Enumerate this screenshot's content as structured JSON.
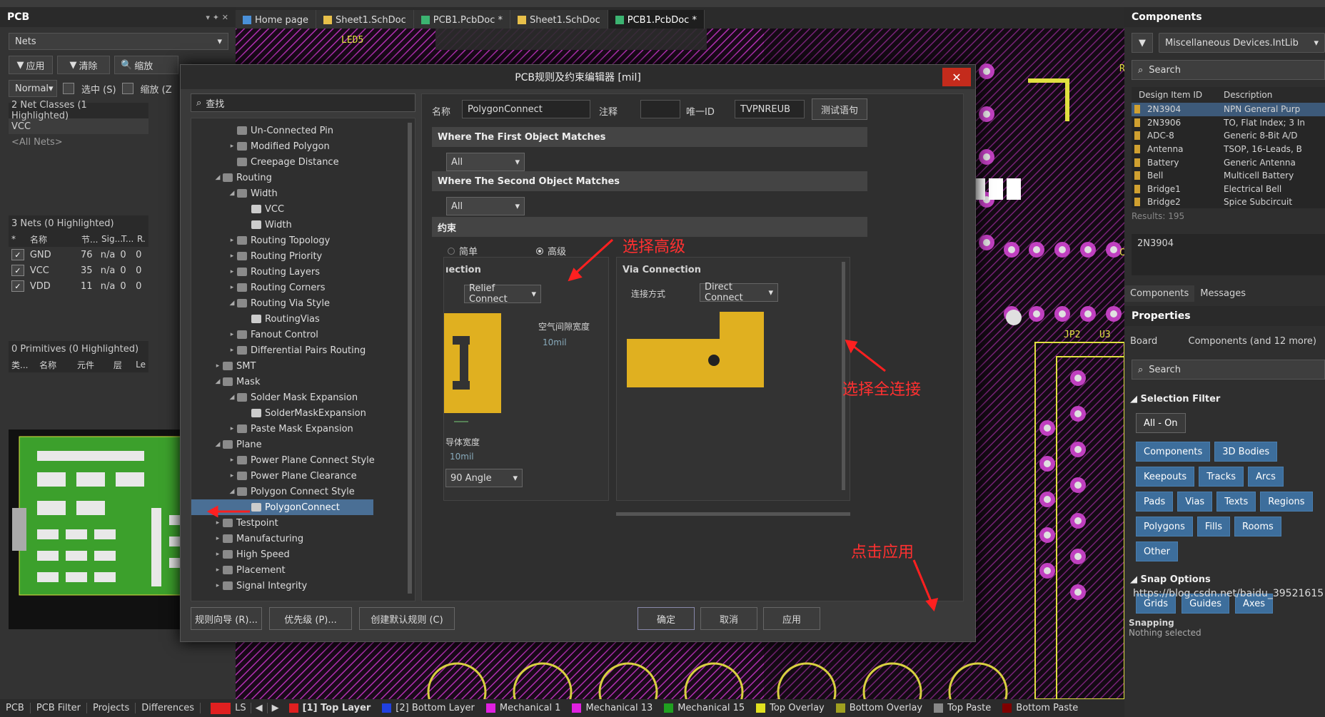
{
  "left_panel": {
    "title": "PCB",
    "title_icons": "▾ ✦ ✕",
    "nets_select": "Nets",
    "apply": "应用",
    "clear": "清除",
    "zoom": "缩放",
    "mode": "Normal",
    "select_chk": "选中 (S)",
    "zoom_chk": "缩放 (Z",
    "net_classes_header": "2 Net Classes (1 Highlighted)",
    "net_classes": [
      "VCC",
      "<All Nets>"
    ],
    "nets_header": "3 Nets (0 Highlighted)",
    "nets_cols": [
      "名称",
      "节...",
      "Sig...",
      "T...",
      "R."
    ],
    "nets": [
      {
        "name": "GND",
        "n": "76",
        "sig": "n/a",
        "t": "0",
        "r": "0"
      },
      {
        "name": "VCC",
        "n": "35",
        "sig": "n/a",
        "t": "0",
        "r": "0"
      },
      {
        "name": "VDD",
        "n": "11",
        "sig": "n/a",
        "t": "0",
        "r": "0"
      }
    ],
    "prims_header": "0 Primitives (0 Highlighted)",
    "prims_cols": [
      "类...",
      "名称",
      "元件",
      "层",
      "Le"
    ]
  },
  "tabs": [
    {
      "label": "Home page",
      "color": "#4a90d9"
    },
    {
      "label": "Sheet1.SchDoc",
      "color": "#e8c04a"
    },
    {
      "label": "PCB1.PcbDoc *",
      "color": "#3cb371"
    },
    {
      "label": "Sheet1.SchDoc",
      "color": "#e8c04a"
    },
    {
      "label": "PCB1.PcbDoc *",
      "color": "#3cb371"
    }
  ],
  "dialog": {
    "title": "PCB规则及约束编辑器 [mil]",
    "search_placeholder": "查找",
    "name_label": "名称",
    "name_value": "PolygonConnect",
    "comment_label": "注释",
    "uid_label": "唯一ID",
    "uid_value": "TVPNREUB",
    "test_btn": "测试语句",
    "first_match": "Where The First Object Matches",
    "second_match": "Where The Second Object Matches",
    "all1": "All",
    "all2": "All",
    "constraint": "约束",
    "simple": "简单",
    "advanced": "高级",
    "conn_label": "ıection",
    "conn_value": "Relief Connect",
    "air_gap": "空气间隙宽度",
    "air_gap_val": "10mil",
    "conductor": "导体宽度",
    "conductor_val": "10mil",
    "angle": "90 Angle",
    "via_conn": "Via Connection",
    "conn_method": "连接方式",
    "direct": "Direct Connect",
    "wizard": "规则向导 (R)...",
    "priority": "优先级 (P)...",
    "default_rules": "创建默认规则 (C)",
    "ok": "确定",
    "cancel": "取消",
    "apply": "应用"
  },
  "tree": [
    {
      "l": "Un-Connected Pin",
      "d": 3,
      "a": ""
    },
    {
      "l": "Modified Polygon",
      "d": 3,
      "a": "▸"
    },
    {
      "l": "Creepage Distance",
      "d": 3,
      "a": ""
    },
    {
      "l": "Routing",
      "d": 2,
      "a": "◢"
    },
    {
      "l": "Width",
      "d": 3,
      "a": "◢"
    },
    {
      "l": "VCC",
      "d": 4,
      "a": ""
    },
    {
      "l": "Width",
      "d": 4,
      "a": ""
    },
    {
      "l": "Routing Topology",
      "d": 3,
      "a": "▸"
    },
    {
      "l": "Routing Priority",
      "d": 3,
      "a": "▸"
    },
    {
      "l": "Routing Layers",
      "d": 3,
      "a": "▸"
    },
    {
      "l": "Routing Corners",
      "d": 3,
      "a": "▸"
    },
    {
      "l": "Routing Via Style",
      "d": 3,
      "a": "◢"
    },
    {
      "l": "RoutingVias",
      "d": 4,
      "a": ""
    },
    {
      "l": "Fanout Control",
      "d": 3,
      "a": "▸"
    },
    {
      "l": "Differential Pairs Routing",
      "d": 3,
      "a": "▸"
    },
    {
      "l": "SMT",
      "d": 2,
      "a": "▸"
    },
    {
      "l": "Mask",
      "d": 2,
      "a": "◢"
    },
    {
      "l": "Solder Mask Expansion",
      "d": 3,
      "a": "◢"
    },
    {
      "l": "SolderMaskExpansion",
      "d": 4,
      "a": ""
    },
    {
      "l": "Paste Mask Expansion",
      "d": 3,
      "a": "▸"
    },
    {
      "l": "Plane",
      "d": 2,
      "a": "◢"
    },
    {
      "l": "Power Plane Connect Style",
      "d": 3,
      "a": "▸"
    },
    {
      "l": "Power Plane Clearance",
      "d": 3,
      "a": "▸"
    },
    {
      "l": "Polygon Connect Style",
      "d": 3,
      "a": "◢"
    },
    {
      "l": "PolygonConnect",
      "d": 4,
      "a": "",
      "sel": true
    },
    {
      "l": "Testpoint",
      "d": 2,
      "a": "▸"
    },
    {
      "l": "Manufacturing",
      "d": 2,
      "a": "▸"
    },
    {
      "l": "High Speed",
      "d": 2,
      "a": "▸"
    },
    {
      "l": "Placement",
      "d": 2,
      "a": "▸"
    },
    {
      "l": "Signal Integrity",
      "d": 2,
      "a": "▸"
    }
  ],
  "annotations": {
    "select_adv": "选择高级",
    "select_full": "选择全连接",
    "click_apply": "点击应用"
  },
  "right_panel": {
    "components_title": "Components",
    "library": "Miscellaneous Devices.IntLib",
    "search": "Search",
    "col_id": "Design Item ID",
    "col_desc": "Description",
    "components": [
      {
        "id": "2N3904",
        "desc": "NPN General Purp"
      },
      {
        "id": "2N3906",
        "desc": "TO, Flat Index; 3 In"
      },
      {
        "id": "ADC-8",
        "desc": "Generic 8-Bit A/D"
      },
      {
        "id": "Antenna",
        "desc": "TSOP, 16-Leads, B"
      },
      {
        "id": "Battery",
        "desc": "Generic Antenna"
      },
      {
        "id": "Bell",
        "desc": "Multicell Battery"
      },
      {
        "id": "Bridge1",
        "desc": "Electrical Bell"
      },
      {
        "id": "Bridge2",
        "desc": "Spice Subcircuit"
      }
    ],
    "results": "Results: 195",
    "selected_item": "2N3904",
    "tab_components": "Components",
    "tab_messages": "Messages",
    "properties": "Properties",
    "board_label": "Board",
    "board_value": "Components (and 12 more)",
    "search2": "Search",
    "selection_filter": "Selection Filter",
    "all_on": "All - On",
    "filters": [
      "Components",
      "3D Bodies",
      "Keepouts",
      "Tracks",
      "Arcs",
      "Pads",
      "Vias",
      "Texts",
      "Regions",
      "Polygons",
      "Fills",
      "Rooms",
      "Other"
    ],
    "snap_options": "Snap Options",
    "snaps": [
      "Grids",
      "Guides",
      "Axes"
    ],
    "snapping": "Snapping",
    "nothing": "Nothing selected",
    "watermark": "https://blog.csdn.net/baidu_39521615"
  },
  "status": {
    "tabs": [
      "PCB",
      "PCB Filter",
      "Projects",
      "Differences"
    ],
    "ls": "LS",
    "layers": [
      {
        "n": "[1] Top Layer",
        "c": "#e02020"
      },
      {
        "n": "[2] Bottom Layer",
        "c": "#2040e0"
      },
      {
        "n": "Mechanical 1",
        "c": "#e020e0"
      },
      {
        "n": "Mechanical 13",
        "c": "#e020e0"
      },
      {
        "n": "Mechanical 15",
        "c": "#20a020"
      },
      {
        "n": "Top Overlay",
        "c": "#e0e020"
      },
      {
        "n": "Bottom Overlay",
        "c": "#a0a020"
      },
      {
        "n": "Top Paste",
        "c": "#888888"
      },
      {
        "n": "Bottom Paste",
        "c": "#800000"
      }
    ]
  }
}
